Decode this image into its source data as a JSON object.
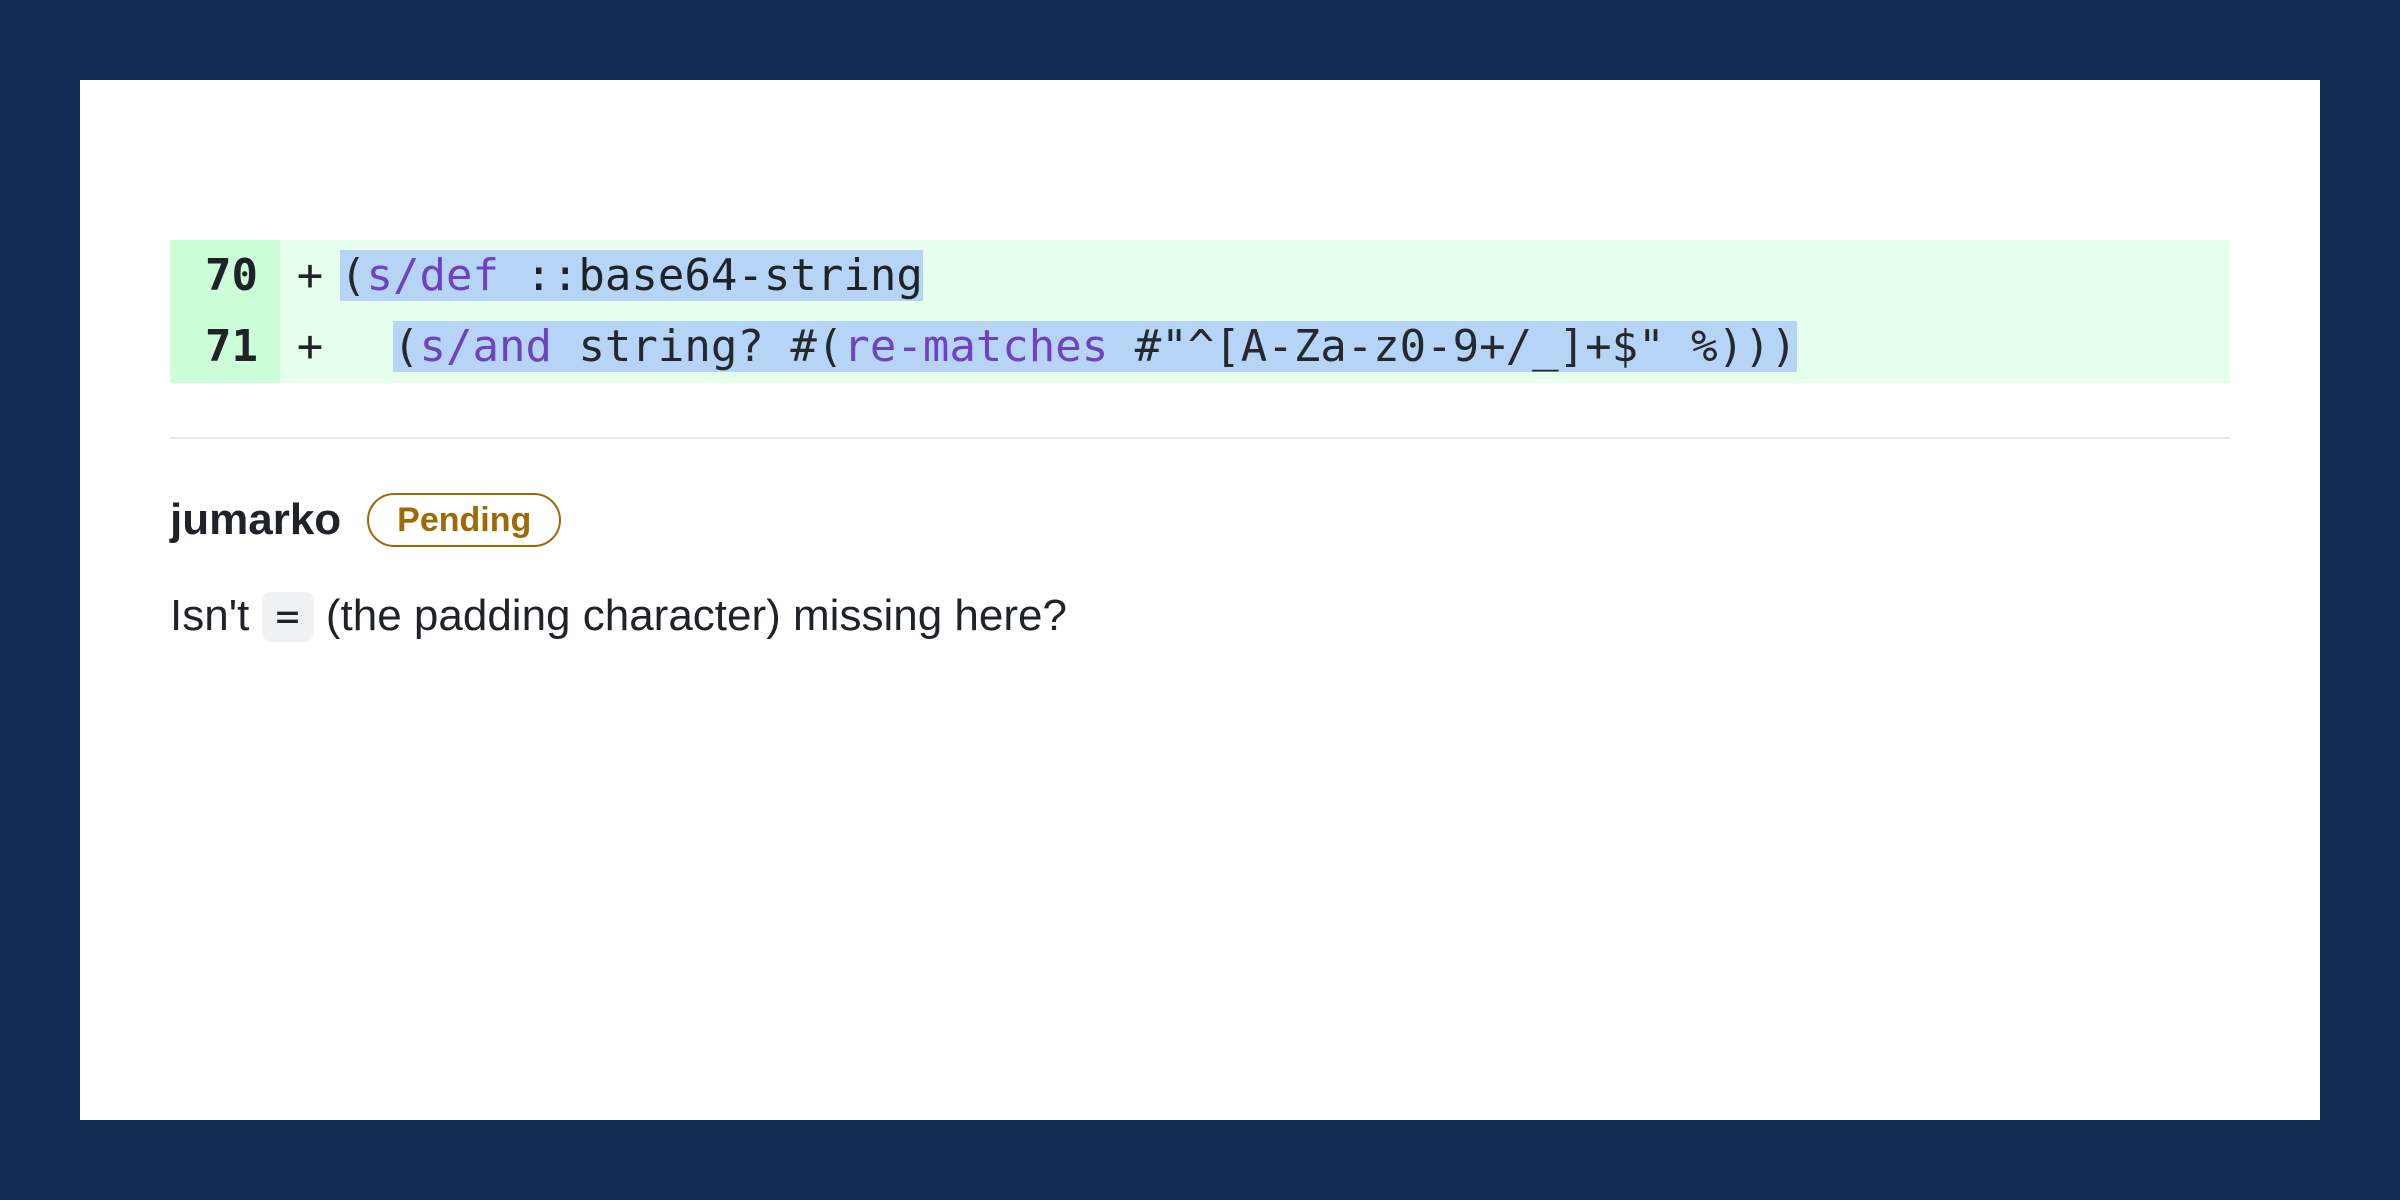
{
  "diff": {
    "lines": [
      {
        "n": "70",
        "marker": "+",
        "open_paren": "(",
        "fn": "s/def",
        "space1": " ",
        "kw": "::base64-string"
      },
      {
        "n": "71",
        "marker": "+",
        "indent": "  ",
        "open_paren": "(",
        "fn": "s/and",
        "space1": " ",
        "pred": "string?",
        "space2": " ",
        "hash_open": "#(",
        "fn2": "re-matches",
        "space3": " ",
        "regex": "#\"^[A-Za-z0-9+/_]+$\"",
        "space4": " ",
        "pct": "%",
        "close": ")))"
      }
    ]
  },
  "comment": {
    "author": "jumarko",
    "badge": "Pending",
    "body_pre": "Isn't ",
    "body_code": "=",
    "body_post": " (the padding character) missing here?"
  }
}
